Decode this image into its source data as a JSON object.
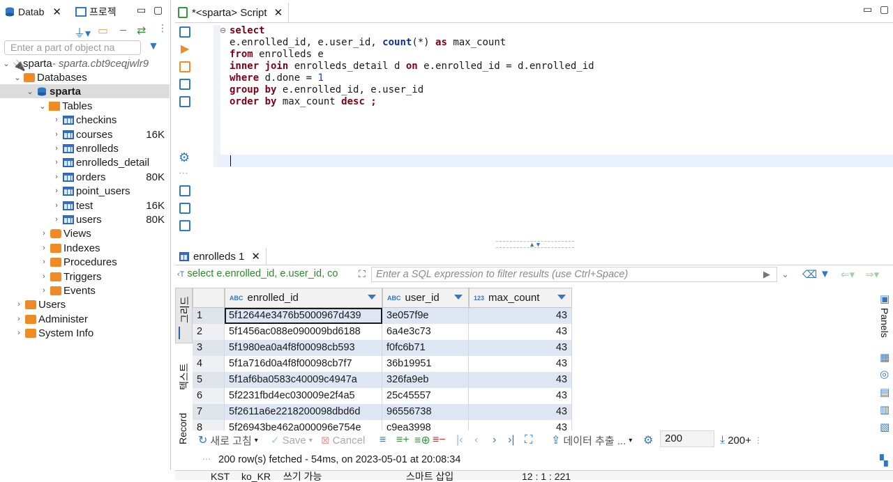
{
  "left_panel": {
    "tab_databases": "Datab",
    "tab_projects": "프로젝",
    "search_placeholder": "Enter a part of object na",
    "connection": {
      "name": "sparta",
      "host": " - sparta.cbt9ceqjwlr9"
    },
    "tree": {
      "databases": "Databases",
      "db": "sparta",
      "tables_folder": "Tables",
      "tables": [
        {
          "name": "checkins",
          "size": ""
        },
        {
          "name": "courses",
          "size": "16K"
        },
        {
          "name": "enrolleds",
          "size": ""
        },
        {
          "name": "enrolleds_detail",
          "size": ""
        },
        {
          "name": "orders",
          "size": "80K"
        },
        {
          "name": "point_users",
          "size": ""
        },
        {
          "name": "test",
          "size": "16K"
        },
        {
          "name": "users",
          "size": "80K"
        }
      ],
      "folders": [
        "Views",
        "Indexes",
        "Procedures",
        "Triggers",
        "Events"
      ],
      "root_items": [
        "Users",
        "Administer",
        "System Info"
      ]
    }
  },
  "editor": {
    "tab_title": "*<sparta> Script",
    "code": {
      "l1": "select",
      "l2a": "e.enrolled_id, e.user_id, ",
      "l2fn": "count",
      "l2b": "(*) ",
      "l2kw": "as",
      "l2c": " max_count",
      "l3kw": "from",
      "l3": " enrolleds e",
      "l4kw": "inner join",
      "l4": " enrolleds_detail d ",
      "l4kw2": "on",
      "l4b": " e.enrolled_id = d.enrolled_id",
      "l5kw": "where",
      "l5": " d.done = ",
      "l5num": "1",
      "l6kw": "group by",
      "l6": " e.enrolled_id, e.user_id",
      "l7kw": "order by",
      "l7": " max_count ",
      "l7kw2": "desc ;"
    }
  },
  "results": {
    "tab_title": "enrolleds 1",
    "query_preview": "select e.enrolled_id, e.user_id, co",
    "filter_placeholder": "Enter a SQL expression to filter results (use Ctrl+Space)",
    "columns": [
      {
        "type": "ABC",
        "name": "enrolled_id"
      },
      {
        "type": "ABC",
        "name": "user_id"
      },
      {
        "type": "123",
        "name": "max_count"
      }
    ],
    "rows": [
      [
        "1",
        "5f12644e3476b5000967d439",
        "3e057f9e",
        "43"
      ],
      [
        "2",
        "5f1456ac088e090009bd6188",
        "6a4e3c73",
        "43"
      ],
      [
        "3",
        "5f1980ea0a4f8f00098cb593",
        "f0fc6b71",
        "43"
      ],
      [
        "4",
        "5f1a716d0a4f8f00098cb7f7",
        "36b19951",
        "43"
      ],
      [
        "5",
        "5f1af6ba0583c40009c4947a",
        "326fa9eb",
        "43"
      ],
      [
        "6",
        "5f2231fbd4ec030009e2f4a5",
        "25c45557",
        "43"
      ],
      [
        "7",
        "5f2611a6e2218200098dbd6d",
        "96556738",
        "43"
      ],
      [
        "8",
        "5f26943be462a000096e754e",
        "c9ea3998",
        "43"
      ]
    ],
    "side_tabs": {
      "grid": "그리드",
      "text": "텍스트",
      "record": "Record"
    },
    "toolbar": {
      "refresh": "새로 고침",
      "save": "Save",
      "cancel": "Cancel",
      "export": "데이터 추출 ...",
      "fetch_size": "200",
      "row_count": "200+"
    },
    "status": "200 row(s) fetched - 54ms, on 2023-05-01 at 20:08:34",
    "panels_label": "Panels"
  },
  "statusbar": {
    "tz": "KST",
    "locale": "ko_KR",
    "mode": "쓰기 가능",
    "insert": "스마트 삽입",
    "position": "12 : 1 : 221"
  }
}
